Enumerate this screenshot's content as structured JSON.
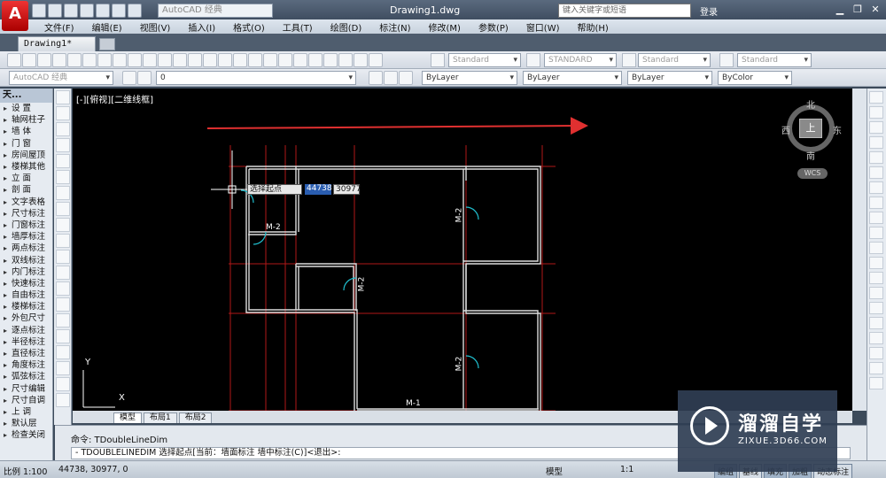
{
  "titlebar": {
    "app_logo": "A",
    "workspace": "AutoCAD 经典",
    "title": "Drawing1.dwg",
    "search_placeholder": "键入关键字或短语",
    "login": "登录"
  },
  "menu": [
    "文件(F)",
    "编辑(E)",
    "视图(V)",
    "插入(I)",
    "格式(O)",
    "工具(T)",
    "绘图(D)",
    "标注(N)",
    "修改(M)",
    "参数(P)",
    "窗口(W)",
    "帮助(H)"
  ],
  "tabs": {
    "document": "Drawing1*"
  },
  "toolbar": {
    "text_style": "Standard",
    "dim_style": "STANDARD",
    "table_style": "Standard",
    "mleader_style": "Standard",
    "workspace2": "AutoCAD 经典",
    "layer": "0",
    "color": "ByLayer",
    "linetype": "ByLayer",
    "lineweight": "ByLayer",
    "plotstyle": "ByColor"
  },
  "left_panel": {
    "title": "天...",
    "items": [
      "设 置",
      "轴网柱子",
      "墙 体",
      "门 窗",
      "房间屋顶",
      "楼梯其他",
      "立 面",
      "剖 面",
      "文字表格",
      "尺寸标注",
      "门窗标注",
      "墙厚标注",
      "两点标注",
      "双线标注",
      "内门标注",
      "快速标注",
      "自由标注",
      "楼梯标注",
      "外包尺寸",
      "逐点标注",
      "半径标注",
      "直径标注",
      "角度标注",
      "弧弦标注",
      "尺寸编辑",
      "尺寸自调",
      "上 调",
      "默认层",
      "检查关闭"
    ]
  },
  "canvas": {
    "view_label": "[-][俯视][二维线框]",
    "compass": {
      "north": "北",
      "south": "南",
      "east": "东",
      "west": "西",
      "top": "上",
      "wcs": "WCS"
    },
    "dynamic_input": {
      "prompt": "选择起点",
      "x": "44738",
      "y": "30977"
    },
    "door_labels": [
      "M-2",
      "M-2",
      "M-2",
      "M-2",
      "M-1"
    ],
    "ucs": {
      "x": "X",
      "y": "Y"
    }
  },
  "layout_tabs": [
    "模型",
    "布局1",
    "布局2"
  ],
  "command": {
    "history": "命令: TDoubleLineDim",
    "prompt": "- TDOUBLELINEDIM 选择起点[当前：墙面标注 墙中标注(C)]<退出>:"
  },
  "statusbar": {
    "scale": "比例 1:100",
    "coords": "44738, 30977, 0",
    "model": "模型",
    "zoom": "1:1",
    "buttons": [
      "编组",
      "基线",
      "填充",
      "加粗",
      "动态标注"
    ]
  },
  "watermark": {
    "title": "溜溜自学",
    "url": "ZIXUE.3D66.COM"
  }
}
